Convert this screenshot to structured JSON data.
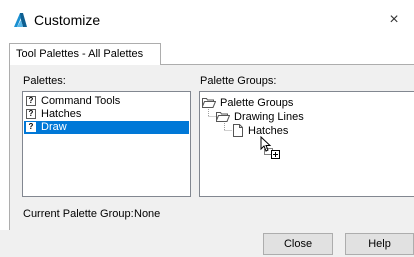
{
  "window": {
    "title": "Customize",
    "close_glyph": "×",
    "app_icon": "autocad-logo-icon"
  },
  "tabs": [
    {
      "label": "Tool Palettes - All Palettes",
      "active": true
    }
  ],
  "palettes": {
    "label": "Palettes:",
    "items": [
      {
        "label": "Command Tools",
        "icon": "palette-item-icon",
        "selected": false
      },
      {
        "label": "Hatches",
        "icon": "palette-item-icon",
        "selected": false
      },
      {
        "label": "Draw",
        "icon": "palette-item-icon",
        "selected": true
      }
    ]
  },
  "palette_groups": {
    "label": "Palette Groups:",
    "tree": [
      {
        "label": "Palette Groups",
        "level": 0,
        "icon": "folder-open-icon"
      },
      {
        "label": "Drawing Lines",
        "level": 1,
        "icon": "folder-open-icon"
      },
      {
        "label": "Hatches",
        "level": 2,
        "icon": "document-icon"
      }
    ]
  },
  "current_group": {
    "label": "Current Palette Group:",
    "value": "None"
  },
  "buttons": {
    "close": "Close",
    "help": "Help"
  },
  "colors": {
    "selection": "#0078d7",
    "accent": "#1a8fd1"
  }
}
